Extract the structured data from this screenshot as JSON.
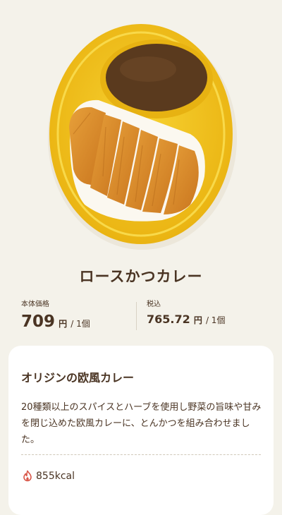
{
  "product": {
    "image_alt": "ロースかつカレー",
    "title": "ロースかつカレー"
  },
  "price": {
    "base_label": "本体価格",
    "base_value": "709",
    "tax_label": "税込",
    "tax_value": "765.72",
    "currency": "円",
    "per_unit": "/ 1個"
  },
  "description": {
    "heading": "オリジンの欧風カレー",
    "body": "20種類以上のスパイスとハーブを使用し野菜の旨味や甘みを閉じ込めた欧風カレーに、とんかつを組み合わせました。"
  },
  "nutrition": {
    "calories": "855kcal",
    "icon": "flame-icon"
  },
  "colors": {
    "background": "#f4f2ea",
    "text": "#4a3423",
    "tray": "#f2c21a",
    "curry": "#5a3a1e",
    "cutlet": "#d98a2a",
    "rice": "#fbf8f0",
    "calorie_icon": "#d9584a"
  }
}
